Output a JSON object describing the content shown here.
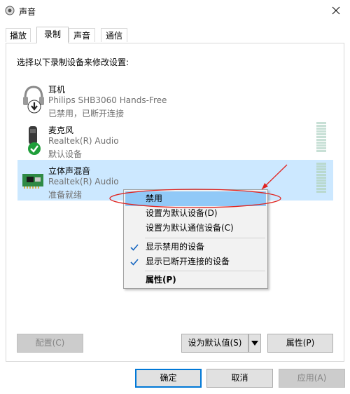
{
  "window": {
    "title": "声音",
    "icons": {
      "app": "speaker-icon",
      "close": "close-icon"
    }
  },
  "tabs": [
    {
      "label": "播放",
      "active": false
    },
    {
      "label": "录制",
      "active": true
    },
    {
      "label": "声音",
      "active": false
    },
    {
      "label": "通信",
      "active": false
    }
  ],
  "instruction": "选择以下录制设备来修改设置:",
  "devices": [
    {
      "name": "耳机",
      "description": "Philips SHB3060 Hands-Free",
      "status": "已禁用，已断开连接",
      "icon": "headset-icon",
      "badge": "down-arrow-badge-icon",
      "selected": false,
      "level_meter": false
    },
    {
      "name": "麦克风",
      "description": "Realtek(R) Audio",
      "status": "默认设备",
      "icon": "microphone-icon",
      "badge": "green-check-badge-icon",
      "selected": false,
      "level_meter": true
    },
    {
      "name": "立体声混音",
      "description": "Realtek(R) Audio",
      "status": "准备就绪",
      "icon": "circuit-board-icon",
      "badge": "",
      "selected": true,
      "level_meter": true
    }
  ],
  "context_menu": {
    "items": [
      {
        "label": "禁用",
        "highlighted": true,
        "checked": false,
        "bold": false
      },
      {
        "label": "设置为默认设备(D)",
        "highlighted": false,
        "checked": false,
        "bold": false
      },
      {
        "label": "设置为默认通信设备(C)",
        "highlighted": false,
        "checked": false,
        "bold": false
      },
      {
        "label": "显示禁用的设备",
        "highlighted": false,
        "checked": true,
        "bold": false
      },
      {
        "label": "显示已断开连接的设备",
        "highlighted": false,
        "checked": true,
        "bold": false
      },
      {
        "label": "属性(P)",
        "highlighted": false,
        "checked": false,
        "bold": true
      }
    ]
  },
  "panel_buttons": {
    "configure": "配置(C)",
    "set_default": "设为默认值(S)",
    "properties": "属性(P)"
  },
  "dialog_buttons": {
    "ok": "确定",
    "cancel": "取消",
    "apply": "应用(A)"
  },
  "colors": {
    "selection": "#cce8ff",
    "menu_highlight": "#91c9f7",
    "annotation": "#e0231f",
    "check_green": "#1f9e3a",
    "default_border": "#0078d7"
  }
}
